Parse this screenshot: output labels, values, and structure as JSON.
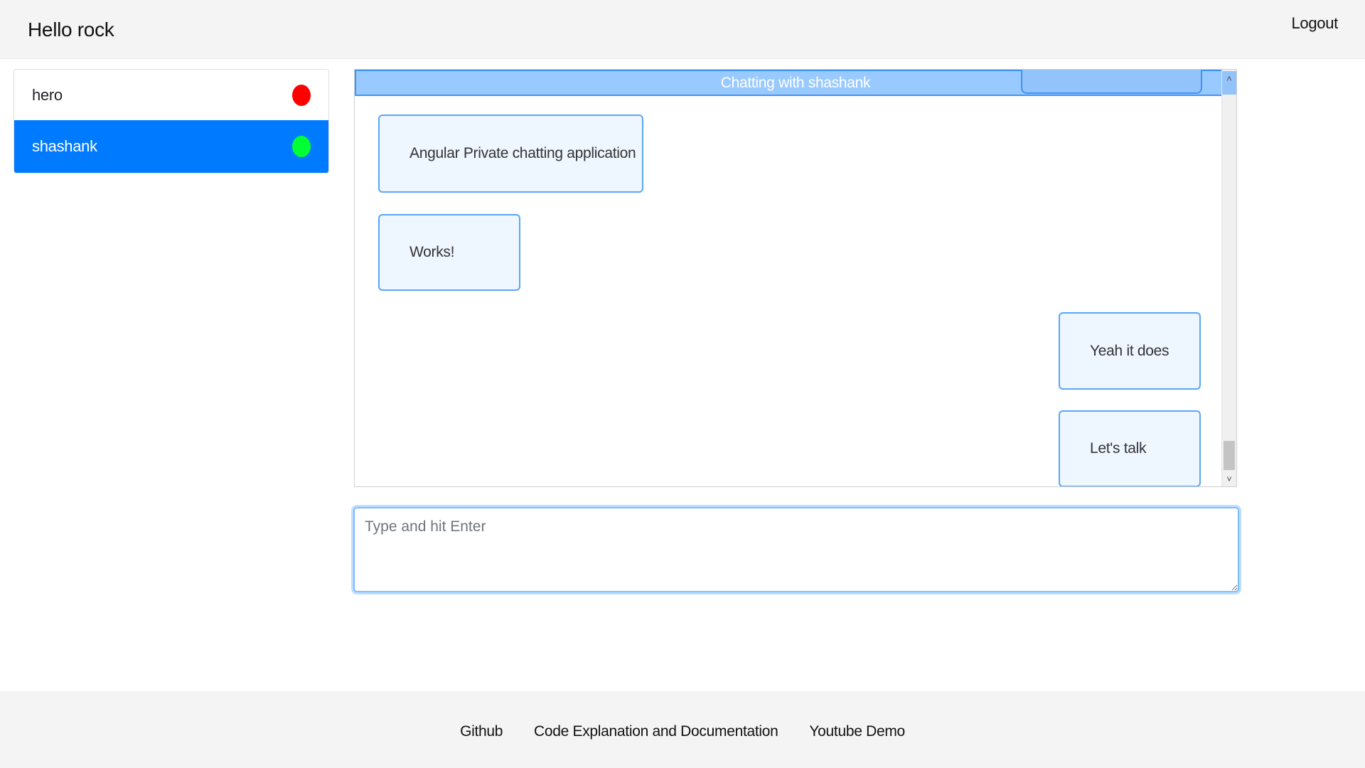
{
  "header": {
    "greeting": "Hello rock",
    "logout_label": "Logout"
  },
  "users": [
    {
      "name": "hero",
      "status": "offline",
      "status_color": "#ff0000",
      "selected": false
    },
    {
      "name": "shashank",
      "status": "online",
      "status_color": "#00ff33",
      "selected": true
    }
  ],
  "chat": {
    "title": "Chatting with shashank",
    "messages": [
      {
        "text": "Angular Private chatting application",
        "side": "left"
      },
      {
        "text": "Works!",
        "side": "left"
      },
      {
        "text": "Yeah it does",
        "side": "right"
      },
      {
        "text": "Let's talk",
        "side": "right"
      }
    ],
    "scroll_up_icon": "˄",
    "scroll_down_icon": "˅"
  },
  "composer": {
    "placeholder": "Type and hit Enter",
    "value": ""
  },
  "footer": {
    "links": [
      "Github",
      "Code Explanation and Documentation",
      "Youtube Demo"
    ]
  },
  "colors": {
    "accent": "#007bff",
    "chat_header_bg": "#99caff",
    "bubble_bg": "#eef6ff",
    "bubble_border": "#5aa6f7"
  }
}
